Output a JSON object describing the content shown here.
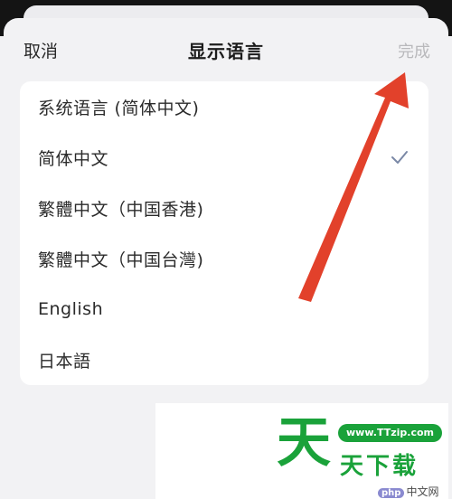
{
  "header": {
    "cancel_label": "取消",
    "title": "显示语言",
    "done_label": "完成"
  },
  "languages": [
    {
      "label": "系统语言 (简体中文)",
      "selected": false
    },
    {
      "label": "简体中文",
      "selected": true
    },
    {
      "label": "繁體中文（中国香港)",
      "selected": false
    },
    {
      "label": "繁體中文（中国台灣)",
      "selected": false
    },
    {
      "label": "English",
      "selected": false
    },
    {
      "label": "日本語",
      "selected": false
    }
  ],
  "colors": {
    "check": "#7a88a6",
    "arrow": "#e2412b",
    "watermark": "#1aa23a"
  },
  "watermark": {
    "big_char": "天",
    "url": "www.TTzip.com",
    "name": "天下载",
    "php_mark": "php",
    "php_text": "中文网"
  }
}
